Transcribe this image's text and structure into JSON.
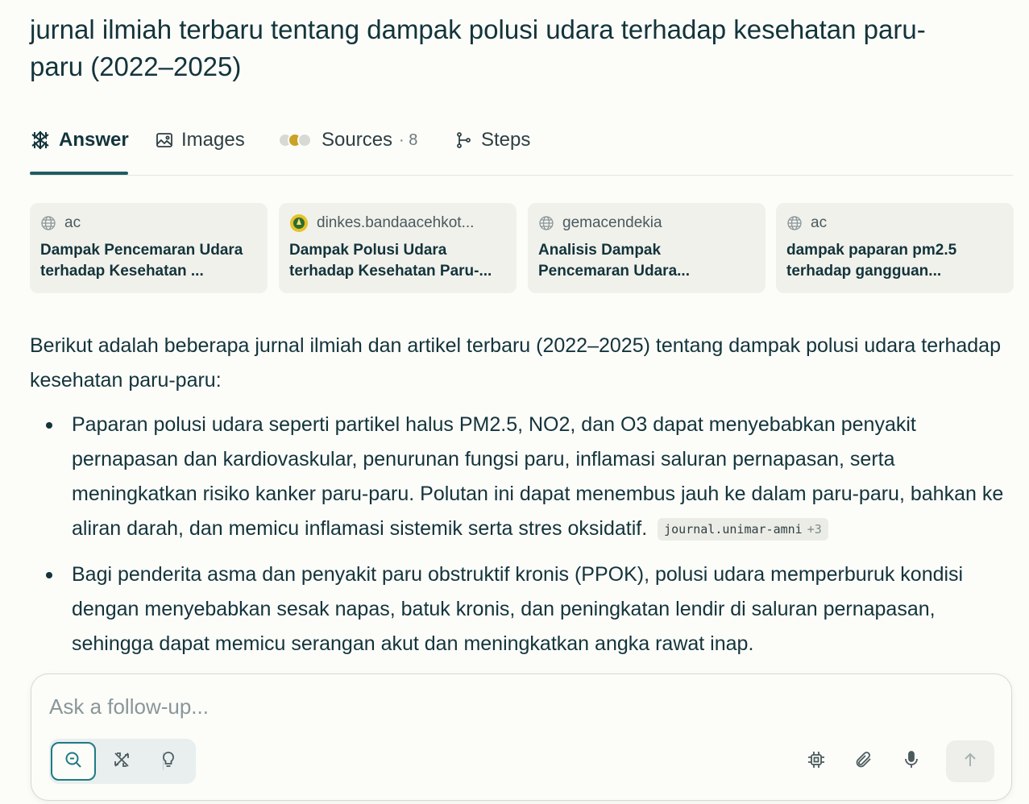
{
  "query": "jurnal ilmiah terbaru tentang dampak polusi udara terhadap kesehatan paru-paru (2022–2025)",
  "tabs": {
    "answer": "Answer",
    "images": "Images",
    "sources": "Sources",
    "sources_count": "· 8",
    "steps": "Steps"
  },
  "source_cards": [
    {
      "domain": "ac",
      "title": "Dampak Pencemaran Udara terhadap Kesehatan ...",
      "icon": "globe-icon"
    },
    {
      "domain": "dinkes.bandaacehkot...",
      "title": "Dampak Polusi Udara terhadap Kesehatan Paru-...",
      "icon": "emblem-icon"
    },
    {
      "domain": "gemacendekia",
      "title": "Analisis Dampak Pencemaran Udara...",
      "icon": "globe-icon"
    },
    {
      "domain": "ac",
      "title": "dampak paparan pm2.5 terhadap gangguan...",
      "icon": "globe-icon"
    }
  ],
  "answer": {
    "intro": "Berikut adalah beberapa jurnal ilmiah dan artikel terbaru (2022–2025) tentang dampak polusi udara terhadap kesehatan paru-paru:",
    "bullets": [
      {
        "text": "Paparan polusi udara seperti partikel halus PM2.5, NO2, dan O3 dapat menyebabkan penyakit pernapasan dan kardiovaskular, penurunan fungsi paru, inflamasi saluran pernapasan, serta meningkatkan risiko kanker paru-paru. Polutan ini dapat menembus jauh ke dalam paru-paru, bahkan ke aliran darah, dan memicu inflamasi sistemik serta stres oksidatif.",
        "citation": "journal.unimar-amni",
        "citation_more": "+3"
      },
      {
        "text": "Bagi penderita asma dan penyakit paru obstruktif kronis (PPOK), polusi udara memperburuk kondisi dengan menyebabkan sesak napas, batuk kronis, dan peningkatan lendir di saluran pernapasan, sehingga dapat memicu serangan akut dan meningkatkan angka rawat inap."
      }
    ]
  },
  "composer": {
    "placeholder": "Ask a follow-up..."
  },
  "colors": {
    "accent": "#1f7a82",
    "text": "#13343b",
    "background": "#fcfcf9",
    "card": "#f1f1ec"
  }
}
